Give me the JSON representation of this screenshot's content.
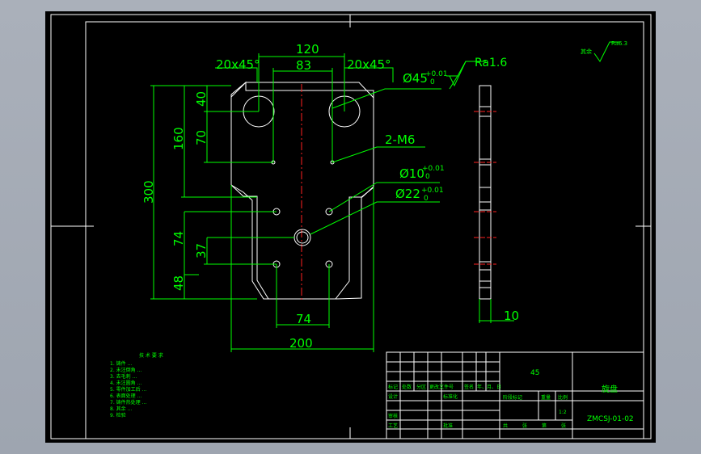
{
  "drawing": {
    "dimensions": {
      "d120": "120",
      "d83": "83",
      "chamfer_left": "20x45°",
      "chamfer_right": "20x45°",
      "hole45": "Ø45",
      "hole45_tol_upper": "+0.01",
      "hole45_tol_lower": "0",
      "roughness": "Ra1.6",
      "thread": "2-M6",
      "hole10": "Ø10",
      "hole10_tol_upper": "+0.01",
      "hole10_tol_lower": "0",
      "hole22": "Ø22",
      "hole22_tol_upper": "+0.01",
      "hole22_tol_lower": "0",
      "d300": "300",
      "d160": "160",
      "d40": "40",
      "d70": "70",
      "d74v": "74",
      "d37": "37",
      "d48": "48",
      "d74h": "74",
      "d200": "200",
      "thickness": "10",
      "surface_other": "其余",
      "surface_other_value": "Ra6.3"
    },
    "notes": {
      "title": "技 术 要 求",
      "items": [
        "1. 铸件 ...",
        "2. 未注倒角 ...",
        "3. 去毛刺 ...",
        "4. 未注圆角 ...",
        "5. 零件加工后 ...",
        "6. 表面处理 ...",
        "7. 铸件热处理 ...",
        "8. 其余 ...",
        "9. 检验"
      ]
    },
    "title_block": {
      "material": "45",
      "part_name": "旋盘",
      "drawing_no": "ZMCSJ-01-02",
      "scale": "1:2",
      "h_mark": "标记",
      "h_count": "处数",
      "h_zone": "分区",
      "h_change": "更改文件号",
      "h_sign": "签名",
      "h_date": "年、月、日",
      "h_design": "设计",
      "h_std": "标准化",
      "h_stage": "阶段标记",
      "h_weight": "重量",
      "h_scale": "比例",
      "h_check": "审核",
      "h_process": "工艺",
      "h_approve": "批准",
      "h_total": "共",
      "h_sheet": "张",
      "h_no": "第",
      "h_sheet2": "张"
    }
  }
}
